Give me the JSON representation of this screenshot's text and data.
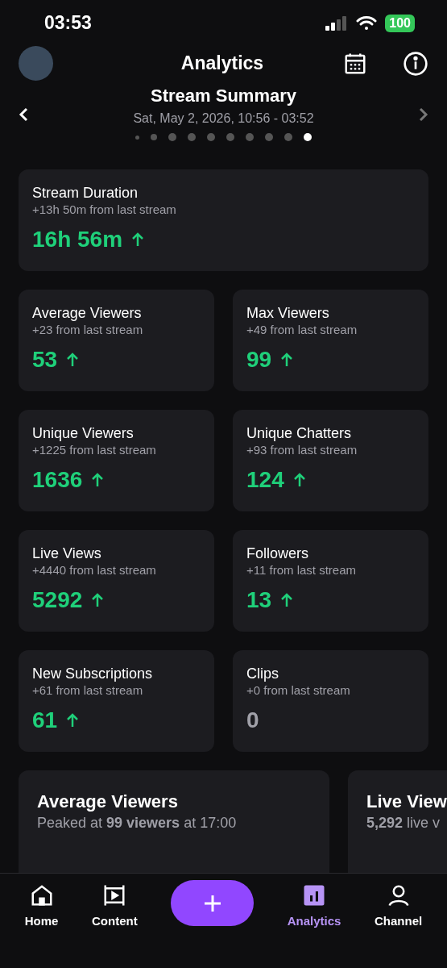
{
  "status_bar": {
    "time": "03:53",
    "battery": "100"
  },
  "header": {
    "title": "Analytics"
  },
  "summary": {
    "title": "Stream Summary",
    "date": "Sat, May 2, 2026, 10:56 - 03:52",
    "pages": [
      {
        "selected": false
      },
      {
        "selected": false
      },
      {
        "selected": false
      },
      {
        "selected": false
      },
      {
        "selected": false
      },
      {
        "selected": false
      },
      {
        "selected": false
      },
      {
        "selected": false
      },
      {
        "selected": false
      },
      {
        "selected": true
      }
    ]
  },
  "stats": [
    {
      "label": "Stream Duration",
      "change": "+13h 50m from last stream",
      "value": "16h 56m",
      "increased": true
    },
    {
      "label": "Average Viewers",
      "change": "+23 from last stream",
      "value": "53",
      "increased": true
    },
    {
      "label": "Max Viewers",
      "change": "+49 from last stream",
      "value": "99",
      "increased": true
    },
    {
      "label": "Unique Viewers",
      "change": "+1225 from last stream",
      "value": "1636",
      "increased": true
    },
    {
      "label": "Unique Chatters",
      "change": "+93 from last stream",
      "value": "124",
      "increased": true
    },
    {
      "label": "Live Views",
      "change": "+4440 from last stream",
      "value": "5292",
      "increased": true
    },
    {
      "label": "Followers",
      "change": "+11 from last stream",
      "value": "13",
      "increased": true
    },
    {
      "label": "New Subscriptions",
      "change": "+61 from last stream",
      "value": "61",
      "increased": true
    },
    {
      "label": "Clips",
      "change": "+0 from last stream",
      "value": "0",
      "increased": false
    }
  ],
  "chart_cards": [
    {
      "title": "Average Viewers",
      "subtitle": "Peaked at **99 viewers** at 17:00"
    },
    {
      "title": "Live View",
      "subtitle": "**5,292** live v"
    }
  ],
  "nav": [
    {
      "kind": "home",
      "label": "Home",
      "selected": false
    },
    {
      "kind": "content",
      "label": "Content",
      "selected": false
    },
    {
      "kind": "create"
    },
    {
      "kind": "analytics",
      "label": "Analytics",
      "selected": true
    },
    {
      "kind": "channel",
      "label": "Channel",
      "selected": false
    }
  ]
}
